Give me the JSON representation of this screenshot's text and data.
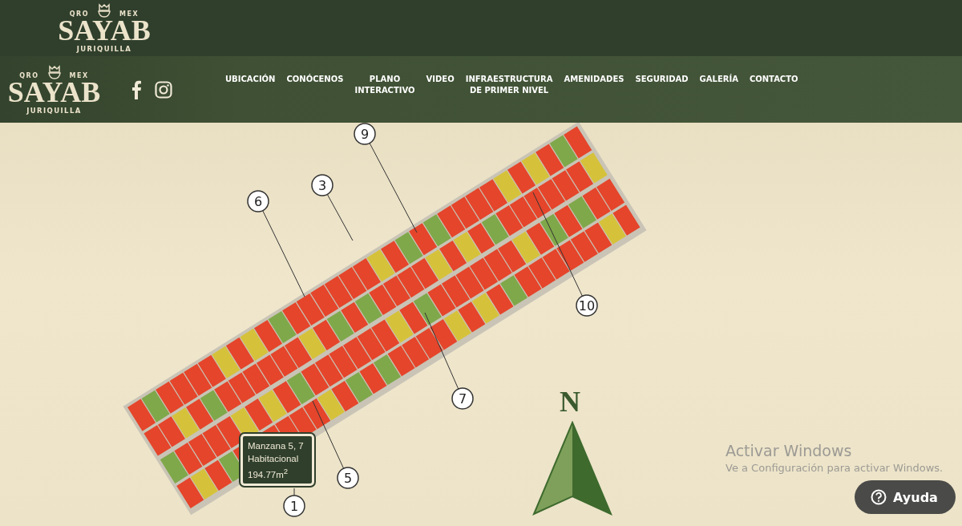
{
  "top_logo": {
    "left": "QRO",
    "right": "MEX",
    "name": "SAYAB",
    "place": "JURIQUILLA"
  },
  "nav": {
    "logo": {
      "left": "QRO",
      "right": "MEX",
      "name": "SAYAB",
      "place": "JURIQUILLA"
    },
    "items": [
      {
        "label": "UBICACIÓN"
      },
      {
        "label": "CONÓCENOS"
      },
      {
        "label": "PLANO\nINTERACTIVO"
      },
      {
        "label": "VIDEO"
      },
      {
        "label": "INFRAESTRUCTURA\nDE PRIMER NIVEL"
      },
      {
        "label": "AMENIDADES"
      },
      {
        "label": "SEGURIDAD"
      },
      {
        "label": "GALERÍA"
      },
      {
        "label": "CONTACTO"
      }
    ]
  },
  "plan": {
    "markers": [
      {
        "label": "9"
      },
      {
        "label": "3"
      },
      {
        "label": "6"
      },
      {
        "label": "10"
      },
      {
        "label": "7"
      },
      {
        "label": "5"
      },
      {
        "label": "1"
      }
    ],
    "tooltip": {
      "block": "Manzana 5, 7",
      "use": "Habitacional",
      "area": "194.77m$^{2}$"
    },
    "compass": {
      "label": "N"
    }
  },
  "os_notice": {
    "title": "Activar Windows",
    "text": "Ve a Configuración para activar Windows."
  },
  "help_button": {
    "label": "Ayuda"
  }
}
